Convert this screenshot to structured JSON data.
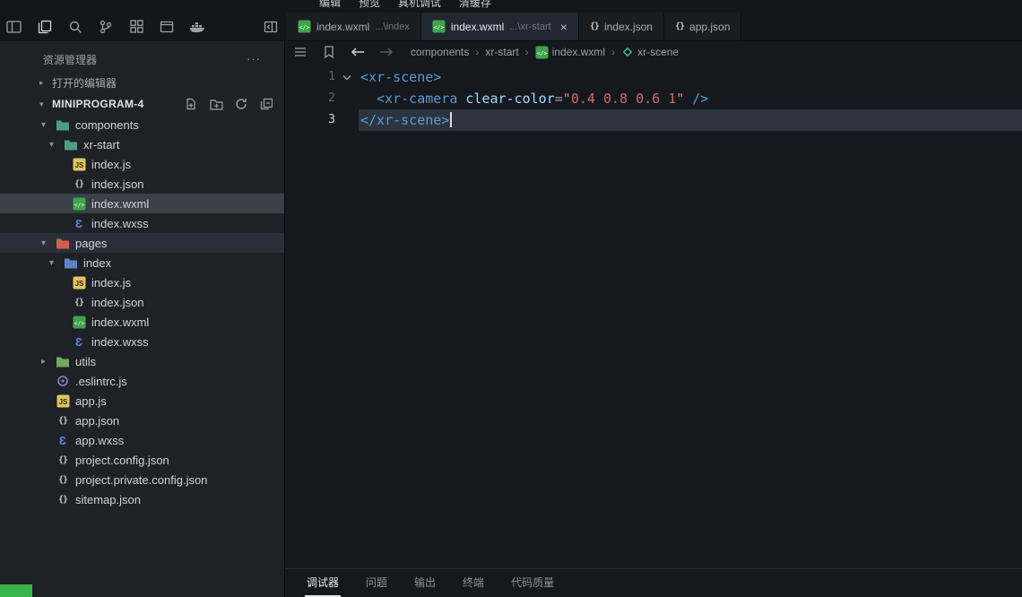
{
  "top_menu": {
    "items": [
      "编辑",
      "预览",
      "真机调试",
      "清缓存"
    ]
  },
  "activity_bar": {
    "icons": [
      "panel-layout",
      "files",
      "search",
      "source-control",
      "extensions",
      "window",
      "docker"
    ],
    "right_icon": "split-editor"
  },
  "tabs": [
    {
      "label": "index.wxml",
      "detail": "...\\index",
      "icon": "wxml",
      "active": false,
      "closable": false
    },
    {
      "label": "index.wxml",
      "detail": "...\\xr-start",
      "icon": "wxml",
      "active": true,
      "closable": true,
      "close_glyph": "×"
    },
    {
      "label": "index.json",
      "detail": "",
      "icon": "json",
      "active": false,
      "closable": false
    },
    {
      "label": "app.json",
      "detail": "",
      "icon": "json",
      "active": false,
      "closable": false
    }
  ],
  "breadcrumb": {
    "separator": "›",
    "items": [
      {
        "label": "components"
      },
      {
        "label": "xr-start"
      },
      {
        "label": "index.wxml",
        "icon": "wxml"
      },
      {
        "label": "xr-scene",
        "icon": "symbol"
      }
    ]
  },
  "editor": {
    "lines": [
      {
        "num": "1",
        "fold": true,
        "tokens": [
          {
            "t": "<xr-scene>",
            "c": "tag"
          }
        ]
      },
      {
        "num": "2",
        "tokens": [
          {
            "t": "  ",
            "c": "plain"
          },
          {
            "t": "<xr-camera",
            "c": "tag"
          },
          {
            "t": " ",
            "c": "plain"
          },
          {
            "t": "clear-color",
            "c": "attr"
          },
          {
            "t": "=",
            "c": "punct"
          },
          {
            "t": "\"",
            "c": "str"
          },
          {
            "t": "0.4",
            "c": "num"
          },
          {
            "t": " ",
            "c": "str"
          },
          {
            "t": "0.8",
            "c": "num"
          },
          {
            "t": " ",
            "c": "str"
          },
          {
            "t": "0.6",
            "c": "num"
          },
          {
            "t": " ",
            "c": "str"
          },
          {
            "t": "1",
            "c": "num"
          },
          {
            "t": "\"",
            "c": "str"
          },
          {
            "t": " ",
            "c": "plain"
          },
          {
            "t": "/>",
            "c": "tag"
          }
        ]
      },
      {
        "num": "3",
        "active": true,
        "caret": true,
        "tokens": [
          {
            "t": "</xr-scene>",
            "c": "tag"
          }
        ]
      }
    ]
  },
  "explorer": {
    "title": "资源管理器",
    "more_glyph": "···",
    "open_editors_arrow": "▸",
    "project_arrow": "▾",
    "sections": {
      "open_editors": "打开的编辑器",
      "project": "MINIPROGRAM-4"
    },
    "project_actions": [
      "new-file",
      "new-folder",
      "refresh",
      "collapse-all"
    ],
    "tree": [
      {
        "label": "components",
        "icon": "folder",
        "color": "#4f9e7f",
        "level": 0,
        "state": "expanded"
      },
      {
        "label": "xr-start",
        "icon": "folder",
        "color": "#4f9e7f",
        "level": 1,
        "state": "expanded"
      },
      {
        "label": "index.js",
        "icon": "js",
        "level": 2
      },
      {
        "label": "index.json",
        "icon": "json",
        "level": 2
      },
      {
        "label": "index.wxml",
        "icon": "wxml",
        "level": 2,
        "selected": true
      },
      {
        "label": "index.wxss",
        "icon": "wxss",
        "level": 2
      },
      {
        "label": "pages",
        "icon": "folder",
        "color": "#d05f48",
        "level": 0,
        "state": "expanded",
        "highlighted": true
      },
      {
        "label": "index",
        "icon": "folder",
        "color": "#5f82c8",
        "level": 1,
        "state": "expanded"
      },
      {
        "label": "index.js",
        "icon": "js",
        "level": 2
      },
      {
        "label": "index.json",
        "icon": "json",
        "level": 2
      },
      {
        "label": "index.wxml",
        "icon": "wxml",
        "level": 2
      },
      {
        "label": "index.wxss",
        "icon": "wxss",
        "level": 2
      },
      {
        "label": "utils",
        "icon": "folder",
        "color": "#74a85e",
        "level": 0,
        "state": "collapsed"
      },
      {
        "label": ".eslintrc.js",
        "icon": "eslint",
        "level": 0
      },
      {
        "label": "app.js",
        "icon": "js",
        "level": 0
      },
      {
        "label": "app.json",
        "icon": "json",
        "level": 0
      },
      {
        "label": "app.wxss",
        "icon": "wxss",
        "level": 0
      },
      {
        "label": "project.config.json",
        "icon": "json",
        "level": 0
      },
      {
        "label": "project.private.config.json",
        "icon": "json",
        "level": 0
      },
      {
        "label": "sitemap.json",
        "icon": "json",
        "level": 0
      }
    ]
  },
  "panel": {
    "tabs": [
      {
        "label": "调试器",
        "active": true
      },
      {
        "label": "问题",
        "active": false
      },
      {
        "label": "输出",
        "active": false
      },
      {
        "label": "终端",
        "active": false
      },
      {
        "label": "代码质量",
        "active": false
      }
    ]
  },
  "colors": {
    "wxml_icon": "#3fa34d",
    "js_icon": "#e2c55a",
    "status_corner": "#39b54a",
    "tag": "#569cd6",
    "attribute": "#9cdcfe",
    "string": "#ce9178",
    "number": "#d16969"
  }
}
